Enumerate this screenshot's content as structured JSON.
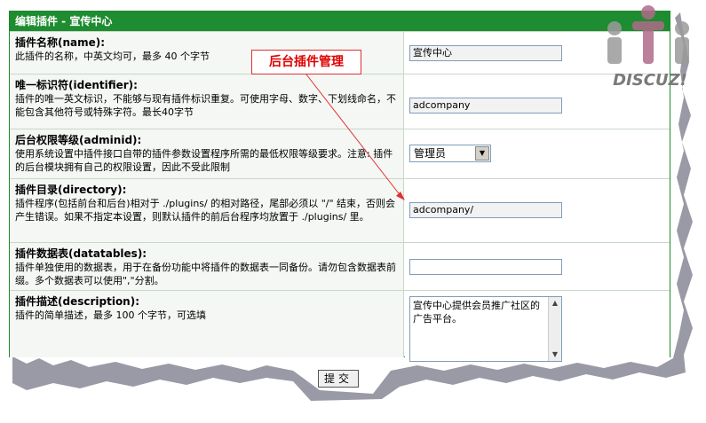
{
  "panel": {
    "title": "编辑插件 - 宣传中心"
  },
  "fields": [
    {
      "label": "插件名称(name):",
      "desc": "此插件的名称，中英文均可，最多 40 个字节",
      "value": "宣传中心"
    },
    {
      "label": "唯一标识符(identifier):",
      "desc": "插件的唯一英文标识，不能够与现有插件标识重复。可使用字母、数字、下划线命名，不能包含其他符号或特殊字符。最长40字节",
      "value": "adcompany"
    },
    {
      "label": "后台权限等级(adminid):",
      "desc": "使用系统设置中插件接口自带的插件参数设置程序所需的最低权限等级要求。注意: 插件的后台模块拥有自己的权限设置，因此不受此限制",
      "value": "管理员"
    },
    {
      "label": "插件目录(directory):",
      "desc": "插件程序(包括前台和后台)相对于 ./plugins/ 的相对路径，尾部必须以 \"/\" 结束，否则会产生错误。如果不指定本设置，则默认插件的前后台程序均放置于 ./plugins/ 里。",
      "value": "adcompany/"
    },
    {
      "label": "插件数据表(datatables):",
      "desc": "插件单独使用的数据表，用于在备份功能中将插件的数据表一同备份。请勿包含数据表前缀。多个数据表可以使用\",\"分割。",
      "value": ""
    },
    {
      "label": "插件描述(description):",
      "desc": "插件的简单描述，最多 100 个字节，可选填",
      "value": "宣传中心提供会员推广社区的广告平台。"
    }
  ],
  "submit_label": "提交",
  "callout": {
    "text": "后台插件管理",
    "color": "#e00000"
  },
  "logo": {
    "text": "DISCUZ!",
    "icon": "discuz-people-logo"
  },
  "colors": {
    "header_bg": "#1e8c30",
    "border": "#1a8a2a"
  }
}
